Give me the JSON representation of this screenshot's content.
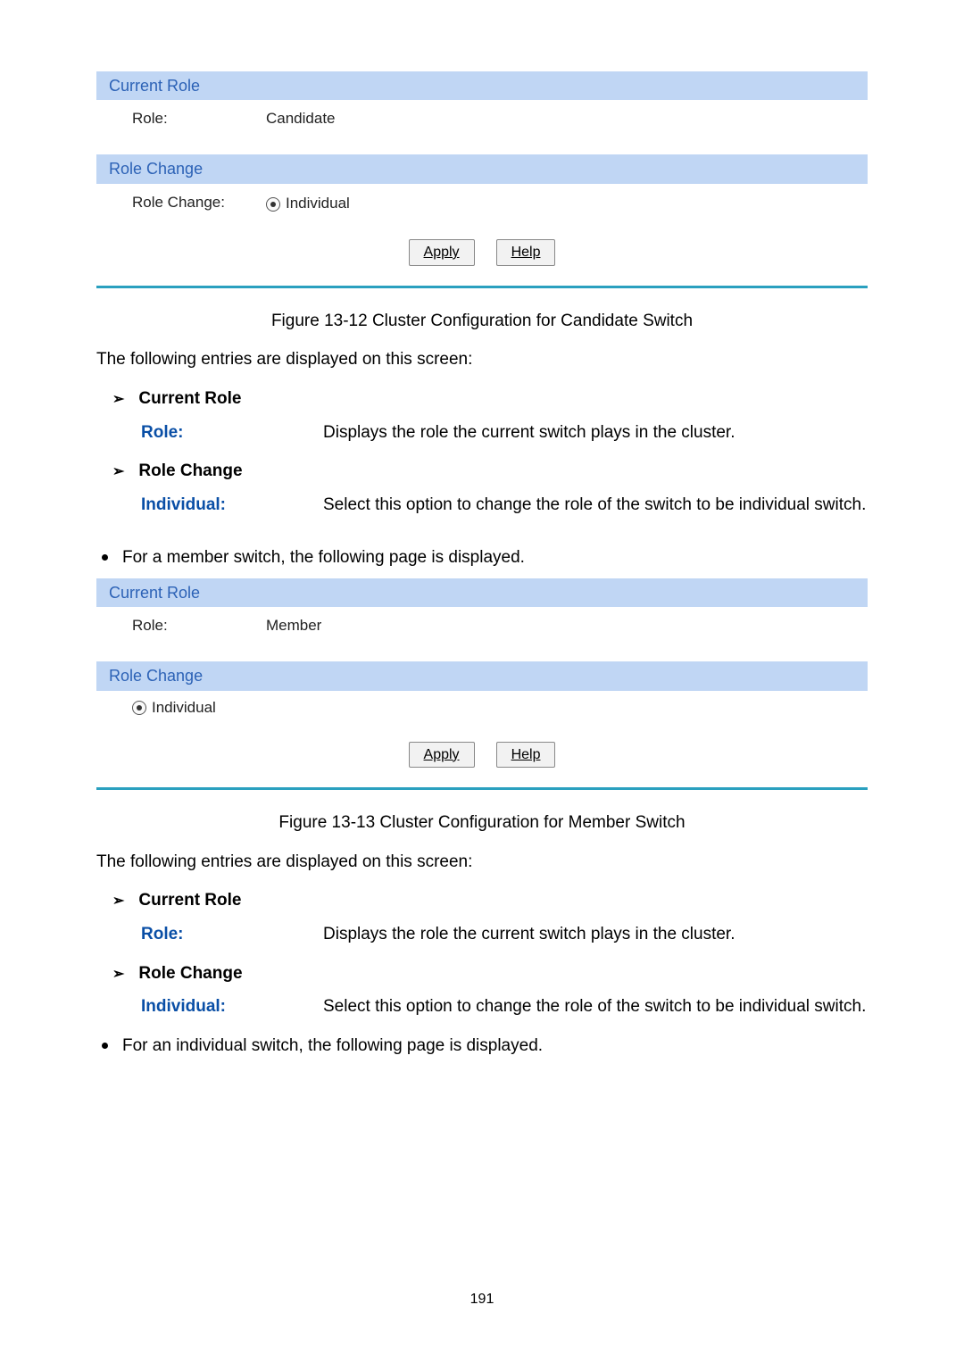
{
  "panel1": {
    "currentRole": {
      "header": "Current Role",
      "roleLabel": "Role:",
      "roleValue": "Candidate"
    },
    "roleChange": {
      "header": "Role Change",
      "label": "Role Change:",
      "optionIndividual": "Individual"
    },
    "buttons": {
      "apply": "Apply",
      "help": "Help"
    }
  },
  "caption1": "Figure 13-12 Cluster Configuration for Candidate Switch",
  "introText": "The following entries are displayed on this screen:",
  "entries": {
    "currentRoleHeading": "Current Role",
    "role": {
      "term": "Role:",
      "desc": "Displays the role the current switch plays in the cluster."
    },
    "roleChangeHeading": "Role Change",
    "individual": {
      "term": "Individual:",
      "desc": "Select this option to change the role of the switch to be individual switch."
    }
  },
  "memberBullet": "For a member switch, the following page is displayed.",
  "panel2": {
    "currentRole": {
      "header": "Current Role",
      "roleLabel": "Role:",
      "roleValue": "Member"
    },
    "roleChange": {
      "header": "Role Change",
      "optionIndividual": "Individual"
    },
    "buttons": {
      "apply": "Apply",
      "help": "Help"
    }
  },
  "caption2": "Figure 13-13 Cluster Configuration for Member Switch",
  "individualBullet": "For an individual switch, the following page is displayed.",
  "pageNumber": "191"
}
